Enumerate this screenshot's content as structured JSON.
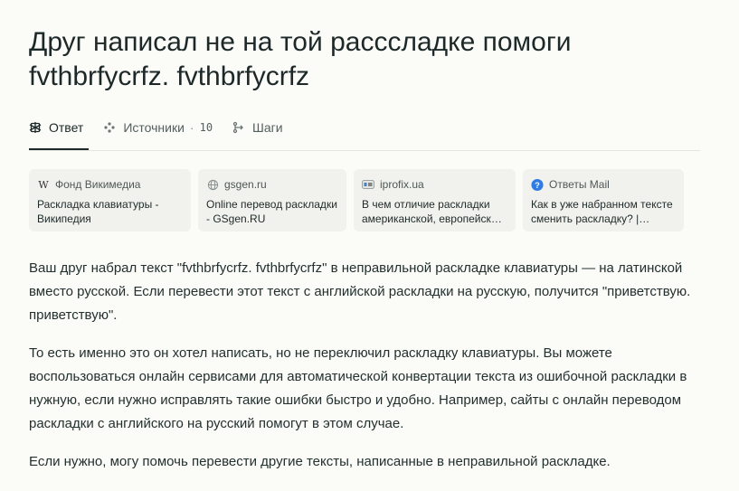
{
  "query": {
    "title": "Друг написал не на той рассcладке помоги fvthbrfycrfz. fvthbrfycrfz"
  },
  "tabs": [
    {
      "label": "Ответ",
      "icon": "answer-icon",
      "active": true
    },
    {
      "label": "Источники",
      "icon": "sources-icon",
      "count": "10",
      "separator": "·"
    },
    {
      "label": "Шаги",
      "icon": "steps-icon"
    }
  ],
  "sources": [
    {
      "site": "Фонд Викимедиа",
      "icon": "wikipedia-icon",
      "title": "Раскладка клавиатуры - Википедия"
    },
    {
      "site": "gsgen.ru",
      "icon": "globe-icon",
      "title": "Online перевод раскладки - GSgen.RU"
    },
    {
      "site": "iprofix.ua",
      "icon": "iprofix-icon",
      "title": "В чем отличие раскладки американской, европейской и..."
    },
    {
      "site": "Ответы Mail",
      "icon": "mail-answers-icon",
      "title": "Как в уже набранном тексте сменить раскладку? | Ответы..."
    }
  ],
  "answer": {
    "paragraphs": [
      "Ваш друг набрал текст \"fvthbrfycrfz. fvthbrfycrfz\" в неправильной раскладке клавиатуры — на латинской вместо русской. Если перевести этот текст с английской раскладки на русскую, получится \"приветствую. приветствую\".",
      "То есть именно это он хотел написать, но не переключил раскладку клавиатуры. Вы можете воспользоваться онлайн сервисами для автоматической конвертации текста из ошибочной раскладки в нужную, если нужно исправлять такие ошибки быстро и удобно. Например, сайты с онлайн переводом раскладки с английского на русский помогут в этом случае.",
      "Если нужно, могу помочь перевести другие тексты, написанные в неправильной раскладке."
    ]
  },
  "colors": {
    "background": "#fbfbf8",
    "card": "#f1f1ed",
    "text": "#1d2828",
    "mail_blue": "#2f7be6"
  }
}
